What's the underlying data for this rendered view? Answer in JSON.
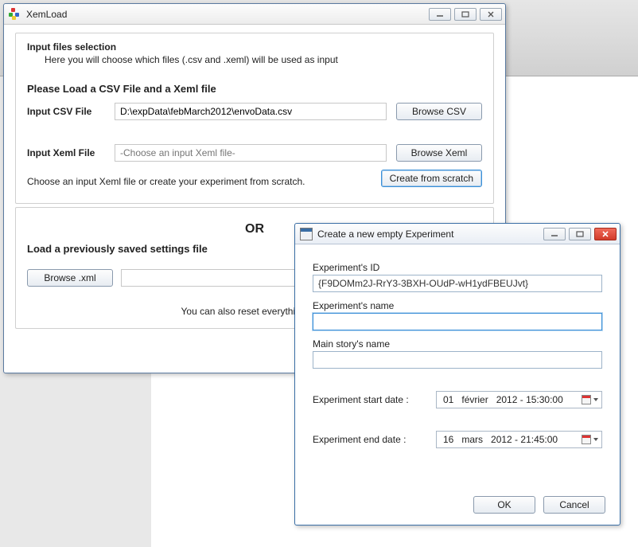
{
  "xemload": {
    "title": "XemLoad",
    "group_title": "Input files selection",
    "group_sub": "Here you will choose which files (.csv and .xeml) will be used as input",
    "section_heading": "Please Load a CSV File and a Xeml file",
    "csv_label": "Input CSV File",
    "csv_value": "D:\\expData\\febMarch2012\\envoData.csv",
    "browse_csv": "Browse CSV",
    "xeml_label": "Input Xeml File",
    "xeml_placeholder": "-Choose an input Xeml file-",
    "browse_xeml": "Browse Xeml",
    "hint": "Choose an input Xeml file or create your experiment from scratch.",
    "create_scratch": "Create from scratch",
    "or": "OR",
    "load_prev": "Load a previously saved settings file",
    "browse_xml": "Browse .xml",
    "bottom_note": "You can also reset everything by cl"
  },
  "dialog": {
    "title": "Create a new empty Experiment",
    "id_label": "Experiment's ID",
    "id_value": "{F9DOMm2J-RrY3-3BXH-OUdP-wH1ydFBEUJvt}",
    "name_label": "Experiment's name",
    "name_value": "",
    "story_label": "Main story's name",
    "story_value": "",
    "start_label": "Experiment start date :",
    "start_day": "01",
    "start_month": "février",
    "start_rest": "2012 - 15:30:00",
    "end_label": "Experiment end date :",
    "end_day": "16",
    "end_month": "mars",
    "end_rest": "2012 - 21:45:00",
    "ok": "OK",
    "cancel": "Cancel"
  }
}
